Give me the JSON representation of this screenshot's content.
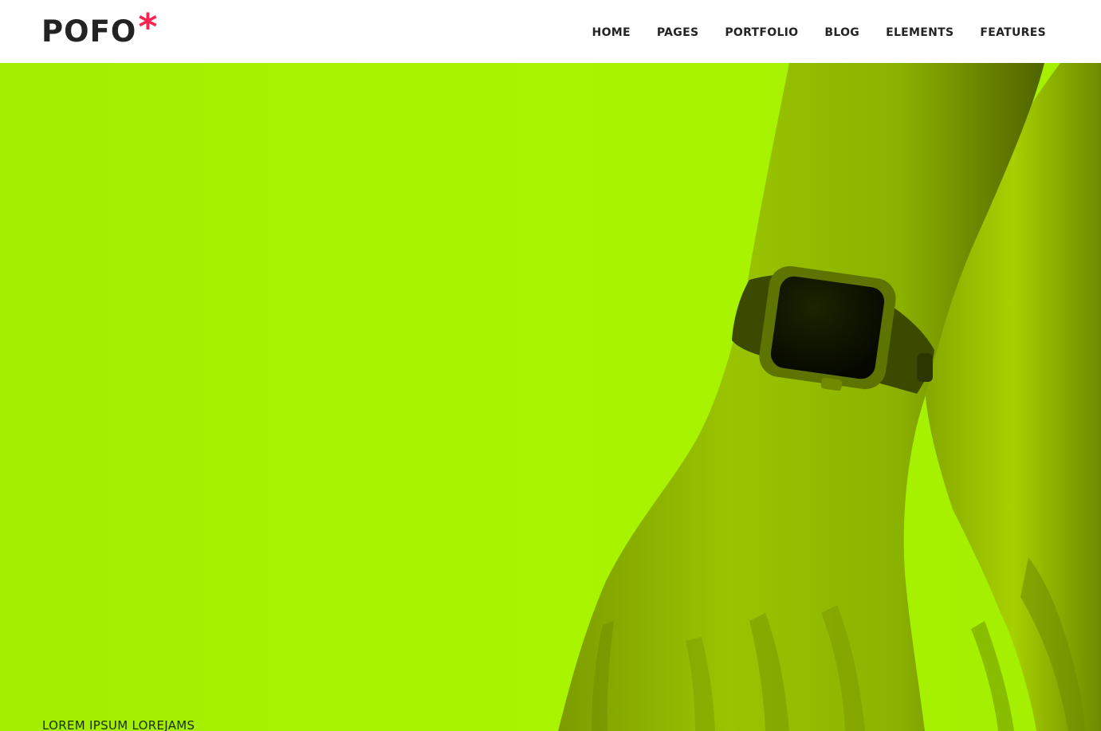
{
  "brand": {
    "name": "POFO",
    "mark": "*",
    "mark_color": "#ff214f"
  },
  "nav": {
    "items": [
      {
        "label": "HOME"
      },
      {
        "label": "PAGES"
      },
      {
        "label": "PORTFOLIO"
      },
      {
        "label": "BLOG"
      },
      {
        "label": "ELEMENTS"
      },
      {
        "label": "FEATURES"
      }
    ]
  },
  "hero": {
    "tagline": "LOREM IPSUM LOREJAMS",
    "background_color": "#a8f400",
    "image_subject": "hand-with-smartwatch"
  }
}
